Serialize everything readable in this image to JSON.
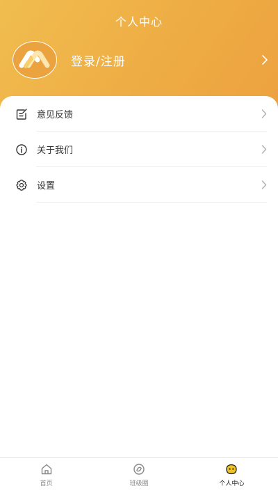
{
  "header": {
    "title": "个人中心",
    "login_label": "登录/注册"
  },
  "menu": {
    "items": [
      {
        "label": "意见反馈",
        "icon": "feedback-icon"
      },
      {
        "label": "关于我们",
        "icon": "info-icon"
      },
      {
        "label": "设置",
        "icon": "gear-icon"
      }
    ]
  },
  "tabbar": {
    "tabs": [
      {
        "label": "首页",
        "icon": "home-icon",
        "active": false
      },
      {
        "label": "班级圈",
        "icon": "class-circle-icon",
        "active": false
      },
      {
        "label": "个人中心",
        "icon": "profile-icon",
        "active": true
      }
    ]
  },
  "colors": {
    "header_gradient_start": "#f1bd4f",
    "header_gradient_end": "#eca03f",
    "active_tab_icon": "#f2c21f"
  }
}
